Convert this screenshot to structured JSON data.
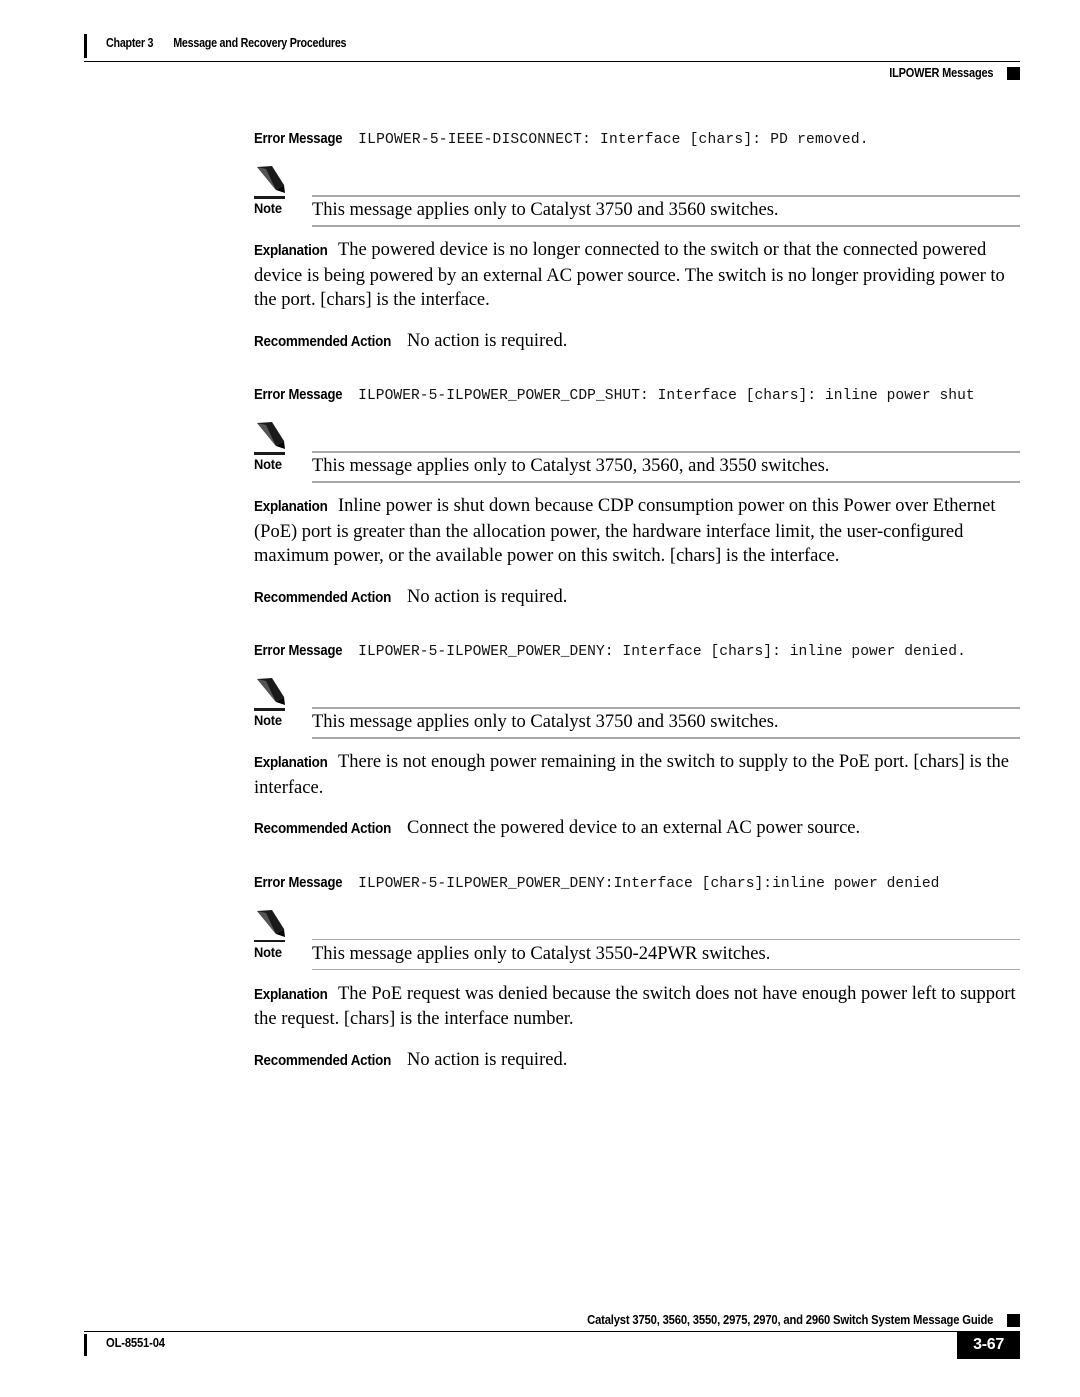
{
  "header": {
    "chapter_number": "Chapter 3",
    "chapter_title": "Message and Recovery Procedures",
    "section_title": "ILPOWER Messages"
  },
  "labels": {
    "error_message": "Error Message",
    "note": "Note",
    "explanation": "Explanation",
    "recommended_action": "Recommended Action"
  },
  "messages": [
    {
      "code": "ILPOWER-5-IEEE-DISCONNECT: Interface [chars]: PD removed.",
      "note": "This message applies only to Catalyst 3750 and 3560 switches.",
      "explanation": "The powered device is no longer connected to the switch or that the connected powered device is being powered by an external AC power source. The switch is no longer providing power to the port. [chars] is the interface.",
      "recommended_action": "No action is required."
    },
    {
      "code": "ILPOWER-5-ILPOWER_POWER_CDP_SHUT: Interface [chars]: inline power shut",
      "note": "This message applies only to Catalyst 3750, 3560, and 3550 switches.",
      "explanation": "Inline power is shut down because CDP consumption power on this Power over Ethernet (PoE) port is greater than the allocation power, the hardware interface limit, the user-configured maximum power, or the available power on this switch. [chars] is the interface.",
      "recommended_action": "No action is required."
    },
    {
      "code": "ILPOWER-5-ILPOWER_POWER_DENY: Interface [chars]: inline power denied.",
      "note": "This message applies only to Catalyst 3750 and 3560 switches.",
      "explanation": "There is not enough power remaining in the switch to supply to the PoE port. [chars] is the interface.",
      "recommended_action": "Connect the powered device to an external AC power source."
    },
    {
      "code": "ILPOWER-5-ILPOWER_POWER_DENY:Interface [chars]:inline power denied",
      "note": "This message applies only to Catalyst 3550-24PWR switches.",
      "explanation": "The PoE request was denied because the switch does not have enough power left to support the request. [chars] is the interface number.",
      "recommended_action": "No action is required."
    }
  ],
  "footer": {
    "guide_title": "Catalyst 3750, 3560, 3550, 2975, 2970, and 2960 Switch System Message Guide",
    "document_id": "OL-8551-04",
    "page_number": "3-67"
  }
}
